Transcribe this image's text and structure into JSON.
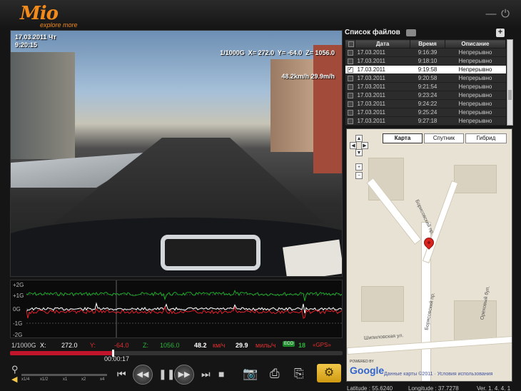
{
  "header": {
    "logo_text": "Mio",
    "logo_tagline": "explore more",
    "minimize_icon": "minimize-icon",
    "power_icon": "power-icon"
  },
  "video": {
    "overlay_left": [
      "17.03.2011 Чт",
      "9:20:15"
    ],
    "overlay_right": [
      "1/1000G  X= 272.0  Y= -64.0  Z= 1056.0",
      "48.2km/h 29.9m/h"
    ]
  },
  "gsensor": {
    "labels": [
      "+2G",
      "+1G",
      "0G",
      "-1G",
      "-2G"
    ],
    "colors": {
      "x": "#ffffff",
      "y": "#e0202a",
      "z": "#1ea82a"
    }
  },
  "readout": {
    "scale": "1/1000G",
    "x_label": "X:",
    "x_value": "272.0",
    "y_label": "Y:",
    "y_value": "-64.0",
    "z_label": "Z:",
    "z_value": "1056.0",
    "speed_kmh": "48.2",
    "kmh_unit": "км/ч",
    "speed_mph": "29.9",
    "mph_unit": "миль/ч",
    "eco_badge": "ECO",
    "eco_value": "18",
    "gps_text": "«GPS»"
  },
  "playback": {
    "elapsed": "00:00:17",
    "progress": 0.31,
    "speeds": [
      "x1/4",
      "x1/2",
      "x1",
      "x2",
      "x4"
    ]
  },
  "file_list": {
    "title": "Список файлов",
    "columns": [
      "Дата",
      "Время",
      "Описание"
    ],
    "rows": [
      {
        "date": "17.03.2011",
        "time": "9:16:39",
        "desc": "Непрерывно",
        "selected": false
      },
      {
        "date": "17.03.2011",
        "time": "9:18:10",
        "desc": "Непрерывно",
        "selected": false
      },
      {
        "date": "17.03.2011",
        "time": "9:19:58",
        "desc": "Непрерывно",
        "selected": true
      },
      {
        "date": "17.03.2011",
        "time": "9:20:58",
        "desc": "Непрерывно",
        "selected": false
      },
      {
        "date": "17.03.2011",
        "time": "9:21:54",
        "desc": "Непрерывно",
        "selected": false
      },
      {
        "date": "17.03.2011",
        "time": "9:23:24",
        "desc": "Непрерывно",
        "selected": false
      },
      {
        "date": "17.03.2011",
        "time": "9:24:22",
        "desc": "Непрерывно",
        "selected": false
      },
      {
        "date": "17.03.2011",
        "time": "9:25:24",
        "desc": "Непрерывно",
        "selected": false
      },
      {
        "date": "17.03.2011",
        "time": "9:27:18",
        "desc": "Непрерывно",
        "selected": false
      }
    ]
  },
  "map": {
    "types": [
      "Карта",
      "Спутник",
      "Гибрид"
    ],
    "active_type": "Карта",
    "streets": [
      "Борисовский пр.",
      "Борисовский пр.",
      "Шипиловская ул.",
      "Ореховый бул."
    ],
    "powered_by": "POWERED BY",
    "google": "Google",
    "attribution": "Данные карты ©2011 · Условия использования",
    "latitude": "Latitude : 55.6240",
    "longitude": "Longitude : 37.7278"
  },
  "version": "Ver. 1. 4. 4. 1"
}
